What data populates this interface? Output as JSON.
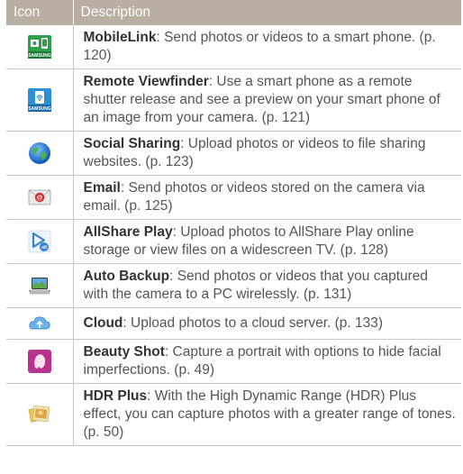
{
  "header": {
    "icon": "Icon",
    "description": "Description"
  },
  "rows": [
    {
      "icon": "mobilelink-icon",
      "name": "MobileLink",
      "text": ": Send photos or videos to a smart phone. (p. 120)"
    },
    {
      "icon": "remote-viewfinder-icon",
      "name": "Remote Viewfinder",
      "text": ": Use a smart phone as a remote shutter release and see a preview on your smart phone of an image from your camera. (p. 121)"
    },
    {
      "icon": "globe-icon",
      "name": "Social Sharing",
      "text": ": Upload photos or videos to file sharing websites. (p. 123)"
    },
    {
      "icon": "email-icon",
      "name": "Email",
      "text": ": Send photos or videos stored on the camera via email. (p. 125)"
    },
    {
      "icon": "allshare-play-icon",
      "name": "AllShare Play",
      "text": ": Upload photos to AllShare Play online storage or view files on a widescreen TV. (p. 128)"
    },
    {
      "icon": "laptop-backup-icon",
      "name": "Auto Backup",
      "text": ": Send photos or videos that you captured with the camera to a PC wirelessly. (p. 131)"
    },
    {
      "icon": "cloud-icon",
      "name": "Cloud",
      "text": ": Upload photos to a cloud server. (p. 133)"
    },
    {
      "icon": "beauty-shot-icon",
      "name": "Beauty Shot",
      "text": ": Capture a portrait with options to hide facial imperfections. (p. 49)"
    },
    {
      "icon": "hdr-plus-icon",
      "name": "HDR Plus",
      "text": ": With the High Dynamic Range (HDR) Plus effect, you can capture photos with a greater range of tones. (p. 50)"
    }
  ],
  "icon_labels": {
    "samsung": "SAMSUNG",
    "allshare_badge": "oll"
  },
  "colors": {
    "header_bg": "#b9aea2",
    "rule": "#cfc6bd",
    "body_text": "#555555"
  }
}
